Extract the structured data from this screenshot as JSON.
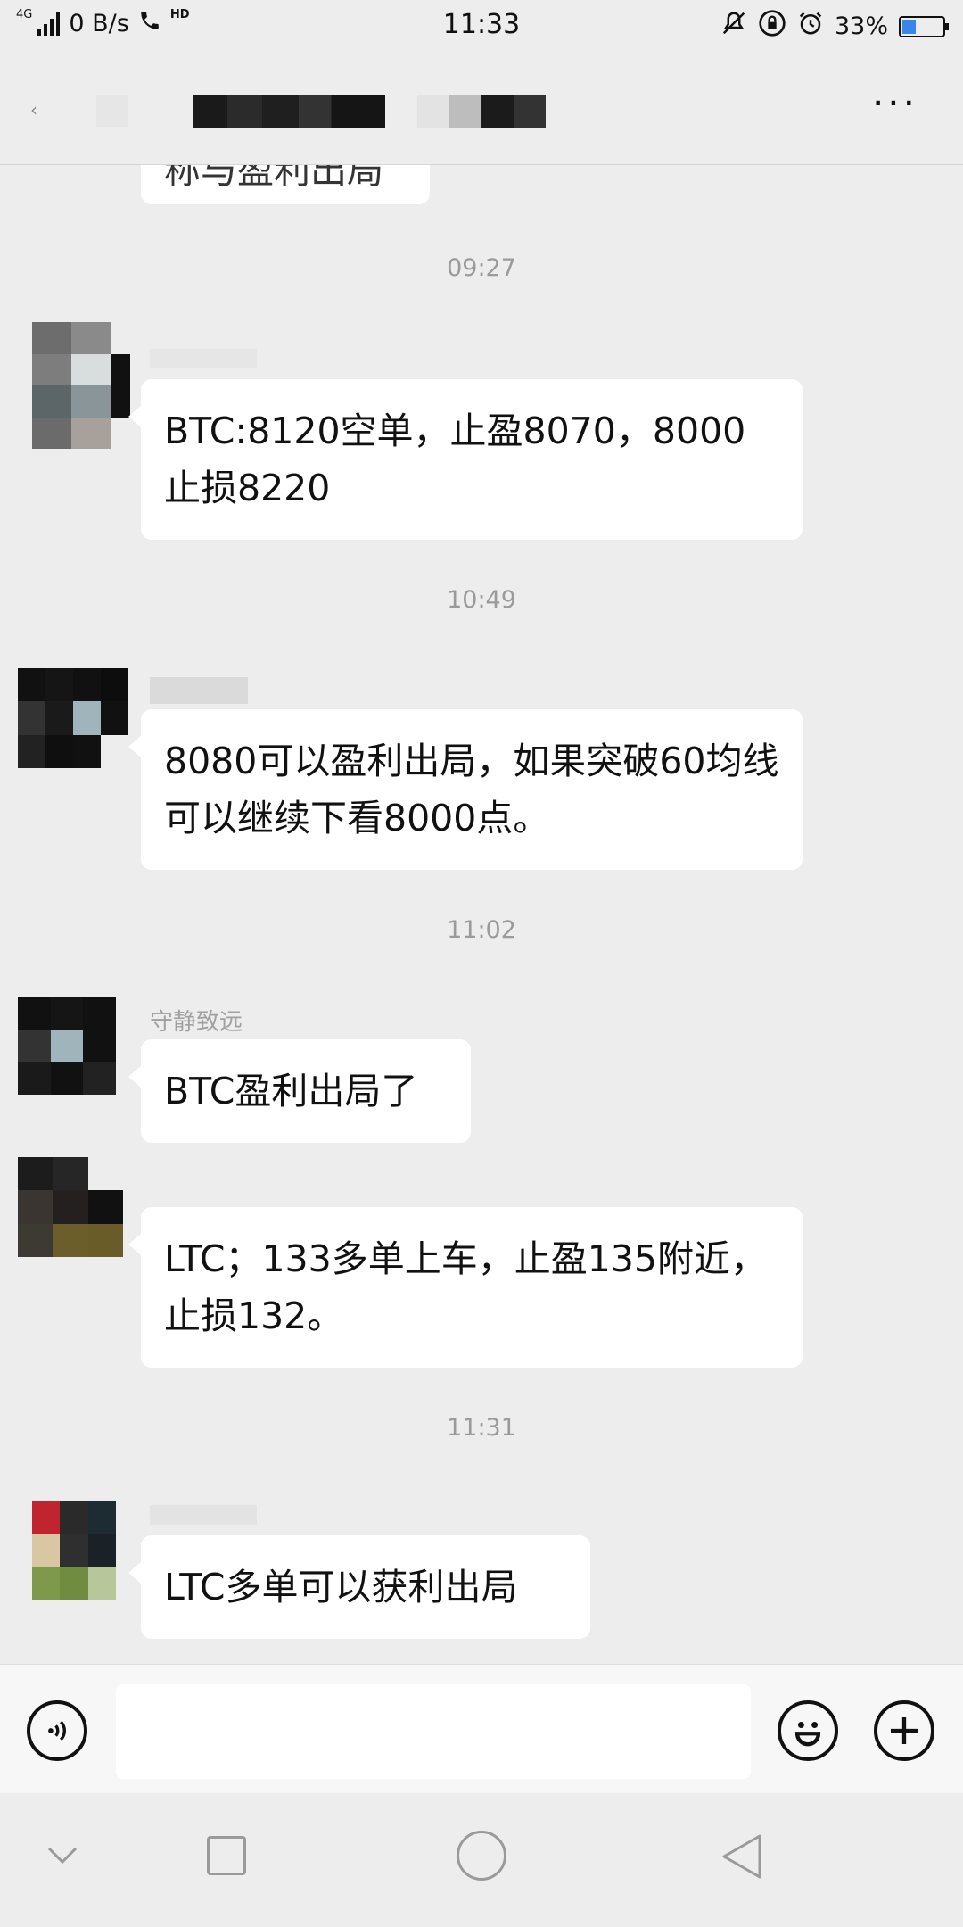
{
  "status_bar": {
    "network": "4G",
    "speed": "0 B/s",
    "call": "HD",
    "time": "11:33",
    "battery": "33%",
    "battery_level": 0.33
  },
  "title_bar": {
    "back_glyph": "‹",
    "more_glyph": "···"
  },
  "chat": {
    "cut_message": "称与盈利出局",
    "messages": [
      {
        "time": "09:27",
        "nickname": "",
        "text": "BTC:8120空单，止盈8070，8000止损8220"
      },
      {
        "time": "10:49",
        "nickname": "",
        "text": "8080可以盈利出局，如果突破60均线可以继续下看8000点。"
      },
      {
        "time": "11:02",
        "nickname": "守静致远",
        "text": "BTC盈利出局了"
      },
      {
        "time": "",
        "nickname": "",
        "text": "LTC；133多单上车，止盈135附近，止损132。"
      },
      {
        "time": "11:31",
        "nickname": "",
        "text": "LTC多单可以获利出局"
      }
    ]
  },
  "input_bar": {
    "voice_icon": "voice-icon",
    "emoji_icon": "emoji-icon",
    "plus_icon": "plus-icon"
  },
  "colors": {
    "background": "#ededed",
    "bubble": "#ffffff",
    "battery_fill": "#3a86e8"
  }
}
